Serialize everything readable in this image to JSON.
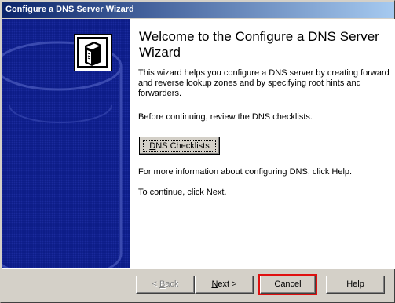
{
  "window": {
    "title": "Configure a DNS Server Wizard"
  },
  "side_panel": {
    "icon": "server-tower-icon"
  },
  "content": {
    "heading": "Welcome to the Configure a DNS Server Wizard",
    "intro": "This wizard helps you configure a DNS server by creating forward and reverse lookup zones and by specifying root hints and forwarders.",
    "review": "Before continuing, review the DNS checklists.",
    "checklists_button": {
      "mnemonic": "D",
      "rest": "NS Checklists"
    },
    "more_info": "For more information about configuring DNS, click Help.",
    "continue": "To continue, click Next."
  },
  "buttons": {
    "back": {
      "prefix": "< ",
      "mnemonic": "B",
      "rest": "ack",
      "enabled": false
    },
    "next": {
      "mnemonic": "N",
      "rest": "ext >",
      "enabled": true
    },
    "cancel": {
      "label": "Cancel",
      "highlighted": true,
      "highlight_color": "#e01010"
    },
    "help": {
      "label": "Help"
    }
  },
  "colors": {
    "titlebar_start": "#0a246a",
    "titlebar_end": "#a6caf0",
    "side_panel": "#0a1a84",
    "dialog_face": "#d4d0c8"
  }
}
